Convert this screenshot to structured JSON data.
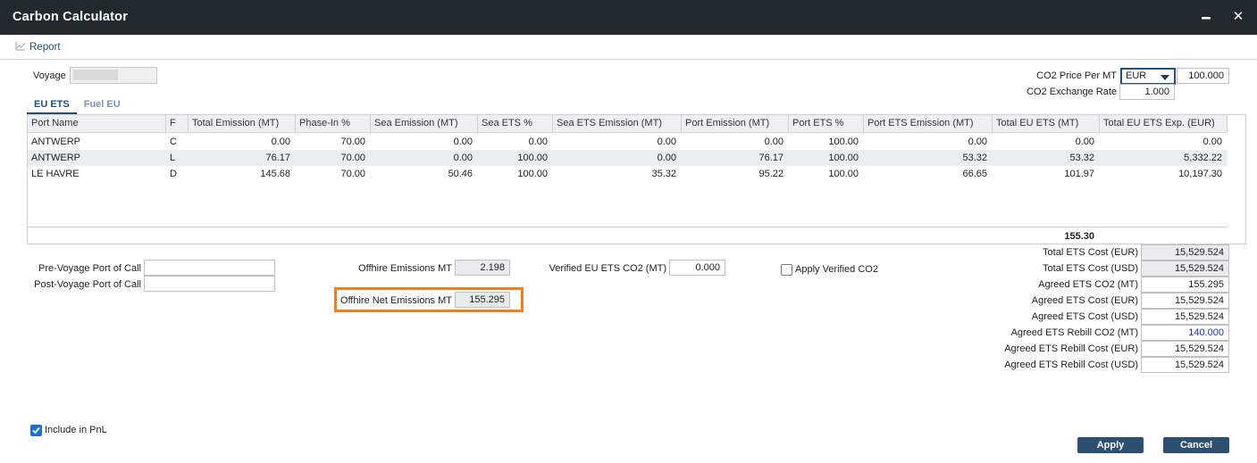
{
  "window": {
    "title": "Carbon Calculator",
    "minimize_glyph": "▬",
    "close_glyph": "✕"
  },
  "toolbar": {
    "report_label": "Report",
    "report_icon": "chart-line-icon"
  },
  "voyage": {
    "label": "Voyage",
    "value": ""
  },
  "co2_price": {
    "label": "CO2 Price Per MT",
    "currency": "EUR",
    "value": "100.000"
  },
  "co2_rate": {
    "label": "CO2 Exchange Rate",
    "value": "1.000"
  },
  "tabs": [
    {
      "label": "EU ETS",
      "active": true
    },
    {
      "label": "Fuel EU",
      "active": false
    }
  ],
  "table": {
    "columns": [
      "Port Name",
      "F",
      "Total Emission (MT)",
      "Phase-In %",
      "Sea Emission (MT)",
      "Sea ETS %",
      "Sea ETS Emission (MT)",
      "Port Emission (MT)",
      "Port ETS %",
      "Port ETS Emission (MT)",
      "Total EU ETS (MT)",
      "Total EU ETS Exp. (EUR)"
    ],
    "rows": [
      [
        "ANTWERP",
        "C",
        "0.00",
        "70.00",
        "0.00",
        "0.00",
        "0.00",
        "0.00",
        "100.00",
        "0.00",
        "0.00",
        "0.00"
      ],
      [
        "ANTWERP",
        "L",
        "76.17",
        "70.00",
        "0.00",
        "100.00",
        "0.00",
        "76.17",
        "100.00",
        "53.32",
        "53.32",
        "5,332.22"
      ],
      [
        "LE HAVRE",
        "D",
        "145.68",
        "70.00",
        "50.46",
        "100.00",
        "35.32",
        "95.22",
        "100.00",
        "66.65",
        "101.97",
        "10,197.30"
      ]
    ],
    "total_eu_ets": "155.30"
  },
  "ports": {
    "pre_label": "Pre-Voyage Port of Call",
    "pre_value": "",
    "post_label": "Post-Voyage Port of Call",
    "post_value": ""
  },
  "offhire": {
    "emissions_label": "Offhire Emissions MT",
    "emissions_value": "2.198",
    "net_label": "Offhire Net Emissions MT",
    "net_value": "155.295"
  },
  "verified": {
    "label": "Verified EU ETS CO2 (MT)",
    "value": "0.000",
    "apply_label": "Apply Verified CO2",
    "apply_checked": false
  },
  "summary": [
    {
      "label": "Total ETS Cost (EUR)",
      "value": "15,529.524",
      "readonly": true,
      "blue": false
    },
    {
      "label": "Total ETS Cost (USD)",
      "value": "15,529.524",
      "readonly": true,
      "blue": false
    },
    {
      "label": "Agreed ETS CO2 (MT)",
      "value": "155.295",
      "readonly": false,
      "blue": false
    },
    {
      "label": "Agreed ETS Cost (EUR)",
      "value": "15,529.524",
      "readonly": false,
      "blue": false
    },
    {
      "label": "Agreed ETS Cost (USD)",
      "value": "15,529.524",
      "readonly": false,
      "blue": false
    },
    {
      "label": "Agreed ETS Rebill CO2 (MT)",
      "value": "140.000",
      "readonly": false,
      "blue": true
    },
    {
      "label": "Agreed ETS Rebill Cost (EUR)",
      "value": "15,529.524",
      "readonly": false,
      "blue": false
    },
    {
      "label": "Agreed ETS Rebill Cost (USD)",
      "value": "15,529.524",
      "readonly": false,
      "blue": false
    }
  ],
  "pnl": {
    "label": "Include in PnL",
    "checked": true
  },
  "buttons": {
    "apply": "Apply",
    "cancel": "Cancel"
  },
  "colors": {
    "titlebar": "#222a30",
    "accent": "#1f4f7a",
    "button": "#2d5070",
    "highlight": "#f07f22",
    "blue_text": "#1a2fbd"
  }
}
